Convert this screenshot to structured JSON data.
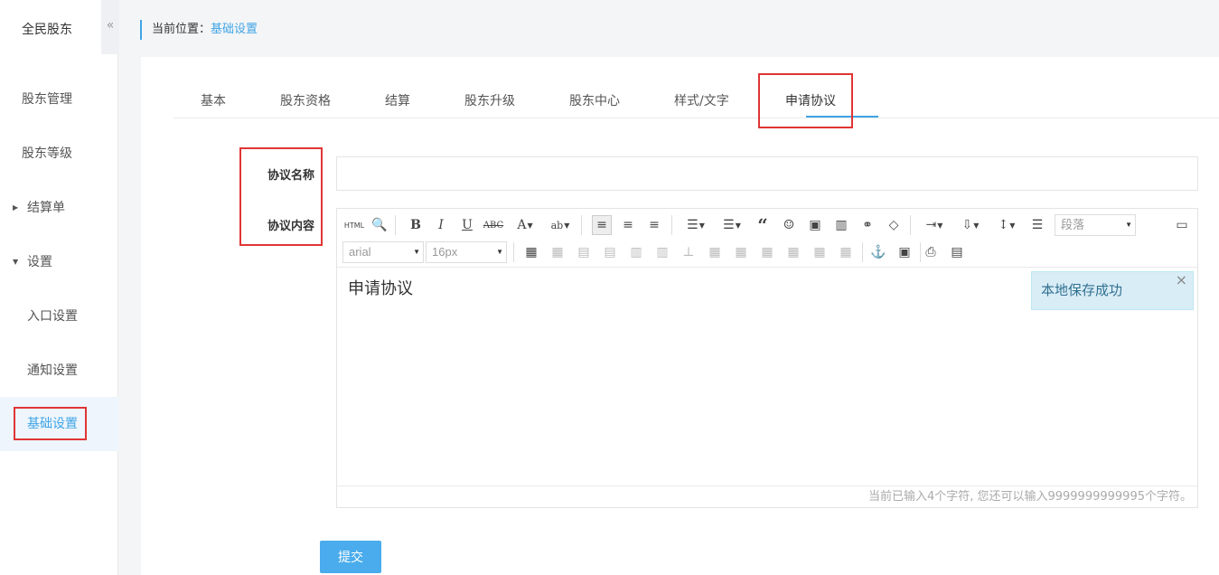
{
  "sidebar": {
    "brand": "全民股东",
    "collapse_icon": "«",
    "items": [
      {
        "label": "股东管理"
      },
      {
        "label": "股东等级"
      },
      {
        "label": "结算单",
        "expanded": false
      },
      {
        "label": "设置",
        "expanded": true
      },
      {
        "label": "入口设置"
      },
      {
        "label": "通知设置"
      },
      {
        "label": "基础设置",
        "active": true
      }
    ]
  },
  "breadcrumb": {
    "prefix": "当前位置：",
    "current": "基础设置"
  },
  "tabs": [
    "基本",
    "股东资格",
    "结算",
    "股东升级",
    "股东中心",
    "样式/文字",
    "申请协议"
  ],
  "active_tab": "申请协议",
  "form": {
    "name_label": "协议名称",
    "name_value": "",
    "content_label": "协议内容",
    "content_value": "申请协议",
    "submit_label": "提交"
  },
  "editor": {
    "html_label": "HTML",
    "paragraph": "段落",
    "font_family": "arial",
    "font_size": "16px",
    "word_count": "当前已输入4个字符, 您还可以输入9999999999995个字符。"
  },
  "toast": {
    "message": "本地保存成功",
    "close_icon": "×"
  },
  "colors": {
    "accent": "#3fa5e6",
    "highlight": "#e03535",
    "button": "#4aacec"
  }
}
